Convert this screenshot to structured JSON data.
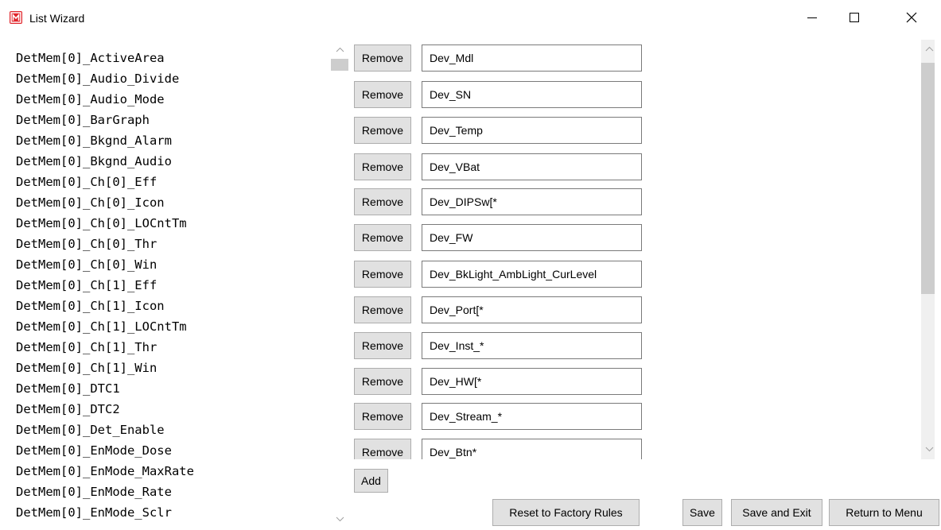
{
  "window": {
    "title": "List Wizard",
    "icon": "app-logo-icon",
    "controls": [
      "minimize-icon",
      "maximize-icon",
      "close-icon"
    ]
  },
  "available_items": [
    "DetMem[0]_ActiveArea",
    "DetMem[0]_Audio_Divide",
    "DetMem[0]_Audio_Mode",
    "DetMem[0]_BarGraph",
    "DetMem[0]_Bkgnd_Alarm",
    "DetMem[0]_Bkgnd_Audio",
    "DetMem[0]_Ch[0]_Eff",
    "DetMem[0]_Ch[0]_Icon",
    "DetMem[0]_Ch[0]_LOCntTm",
    "DetMem[0]_Ch[0]_Thr",
    "DetMem[0]_Ch[0]_Win",
    "DetMem[0]_Ch[1]_Eff",
    "DetMem[0]_Ch[1]_Icon",
    "DetMem[0]_Ch[1]_LOCntTm",
    "DetMem[0]_Ch[1]_Thr",
    "DetMem[0]_Ch[1]_Win",
    "DetMem[0]_DTC1",
    "DetMem[0]_DTC2",
    "DetMem[0]_Det_Enable",
    "DetMem[0]_EnMode_Dose",
    "DetMem[0]_EnMode_MaxRate",
    "DetMem[0]_EnMode_Rate",
    "DetMem[0]_EnMode_Sclr"
  ],
  "rules": {
    "remove_label": "Remove",
    "values": [
      "Dev_Mdl",
      "Dev_SN",
      "Dev_Temp",
      "Dev_VBat",
      "Dev_DIPSw[*",
      "Dev_FW",
      "Dev_BkLight_AmbLight_CurLevel",
      "Dev_Port[*",
      "Dev_Inst_*",
      "Dev_HW[*",
      "Dev_Stream_*",
      "Dev_Btn*"
    ],
    "add_label": "Add"
  },
  "footer": {
    "reset_label": "Reset to Factory Rules",
    "save_label": "Save",
    "save_exit_label": "Save and Exit",
    "return_label": "Return to Menu"
  }
}
